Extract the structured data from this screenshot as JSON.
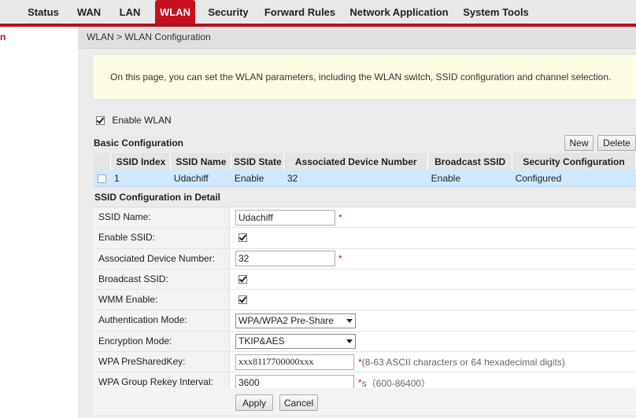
{
  "topnav": {
    "items": [
      {
        "label": "Status",
        "active": false
      },
      {
        "label": "WAN",
        "active": false
      },
      {
        "label": "LAN",
        "active": false
      },
      {
        "label": "WLAN",
        "active": true
      },
      {
        "label": "Security",
        "active": false
      },
      {
        "label": "Forward Rules",
        "active": false
      },
      {
        "label": "Network Application",
        "active": false
      },
      {
        "label": "System Tools",
        "active": false
      }
    ]
  },
  "sidebar": {
    "items": [
      {
        "label": "n"
      }
    ]
  },
  "breadcrumb": "WLAN > WLAN Configuration",
  "info_text": "On this page, you can set the WLAN parameters, including the WLAN switch, SSID configuration and channel selection.",
  "enable_wlan": {
    "label": "Enable WLAN",
    "checked": true
  },
  "basic_config": {
    "title": "Basic Configuration",
    "new_label": "New",
    "delete_label": "Delete",
    "columns": [
      "SSID Index",
      "SSID Name",
      "SSID State",
      "Associated Device Number",
      "Broadcast SSID",
      "Security Configuration"
    ],
    "rows": [
      {
        "index": "1",
        "name": "Udachiff",
        "state": "Enable",
        "devices": "32",
        "broadcast": "Enable",
        "security": "Configured"
      }
    ]
  },
  "detail": {
    "title": "SSID Configuration in Detail",
    "ssid_name_label": "SSID Name:",
    "ssid_name_value": "Udachiff",
    "enable_ssid_label": "Enable SSID:",
    "assoc_label": "Associated Device Number:",
    "assoc_value": "32",
    "broadcast_label": "Broadcast SSID:",
    "wmm_label": "WMM Enable:",
    "auth_label": "Authentication Mode:",
    "auth_value": "WPA/WPA2 Pre-Share",
    "enc_label": "Encryption Mode:",
    "enc_value": "TKIP&AES",
    "psk_label": "WPA PreSharedKey:",
    "psk_value": "xxx8117700000xxx",
    "psk_hint": "(8-63 ASCII characters or 64 hexadecimal digits)",
    "rekey_label": "WPA Group Rekey Interval:",
    "rekey_value": "3600",
    "rekey_hint": "s（600-86400）",
    "required_mark": "*"
  },
  "buttons": {
    "apply": "Apply",
    "cancel": "Cancel"
  },
  "colors": {
    "accent": "#c8101e",
    "selected_row": "#cfe8fb",
    "info_bg": "#fdfde6"
  }
}
